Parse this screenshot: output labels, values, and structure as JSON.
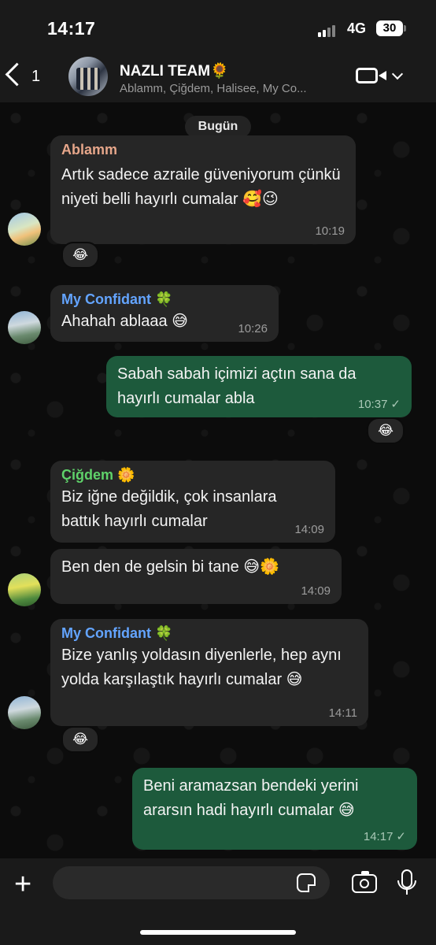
{
  "status_bar": {
    "time": "14:17",
    "network": "4G",
    "battery": "30"
  },
  "header": {
    "back_count": "1",
    "title": "NAZLI TEAM🌻",
    "members": "Ablamm, Çiğdem, Halisee, My Co...",
    "icons": {
      "back": "chevron-left-icon",
      "video": "video-call-icon",
      "menu": "chevron-down-icon"
    }
  },
  "date_separator": "Bugün",
  "messages": [
    {
      "sender": "Ablamm",
      "sender_color": "#e6a68a",
      "text": "Artık sadece azraile güveniyorum çünkü niyeti belli hayırlı cumalar 🥰😉",
      "time": "10:19",
      "reaction": "😂"
    },
    {
      "sender": "My Confidant 🍀",
      "sender_color": "#63a4ff",
      "text": "Ahahah ablaaa 😅",
      "time": "10:26"
    },
    {
      "outgoing": true,
      "text": "Sabah sabah içimizi açtın sana da hayırlı cumalar abla",
      "time": "10:37",
      "status": "✓",
      "reaction": "😂"
    },
    {
      "sender": "Çiğdem 🌼",
      "sender_color": "#5fd26a",
      "text": "Biz iğne değildik, çok insanlara battık hayırlı cumalar",
      "time": "14:09"
    },
    {
      "text": "Ben den de gelsin bi tane 😅🌼",
      "time": "14:09"
    },
    {
      "sender": "My Confidant 🍀",
      "sender_color": "#63a4ff",
      "text": "Bize yanlış yoldasın diyenlerle, hep aynı yolda karşılaştık hayırlı cumalar 😅",
      "time": "14:11",
      "reaction": "😂"
    },
    {
      "outgoing": true,
      "text": "Beni aramazsan bendeki yerini ararsın hadi hayırlı cumalar 😅",
      "time": "14:17",
      "status": "✓"
    }
  ],
  "input": {
    "icons": {
      "add": "plus-icon",
      "sticker": "sticker-icon",
      "camera": "camera-icon",
      "mic": "microphone-icon"
    }
  }
}
